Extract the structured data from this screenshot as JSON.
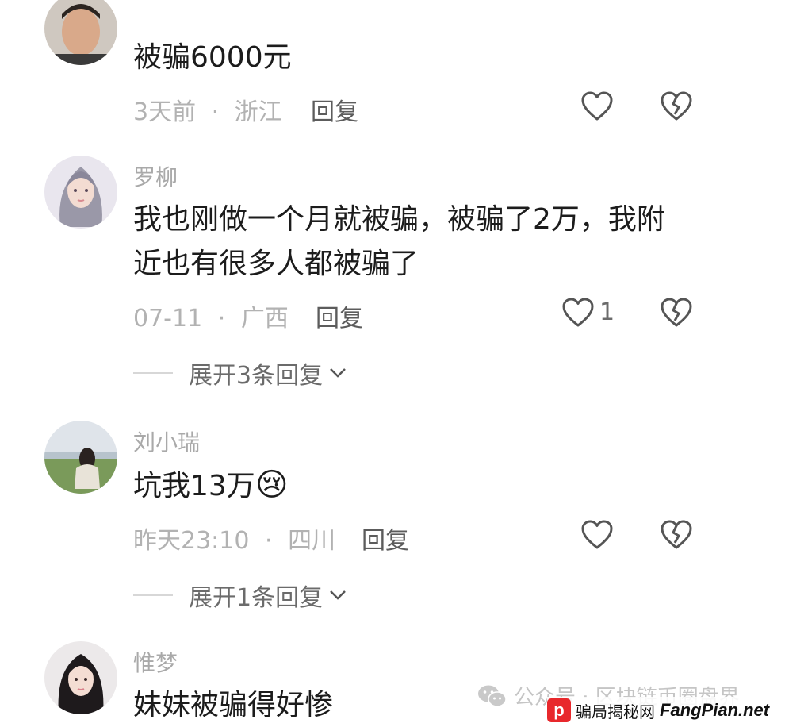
{
  "comments": [
    {
      "author": "",
      "text": "被骗6000元",
      "time": "3天前",
      "location": "浙江",
      "reply_label": "回复",
      "likes": ""
    },
    {
      "author": "罗柳",
      "text_line1": "我也刚做一个月就被骗，被骗了2万，我附",
      "text_line2": "近也有很多人都被骗了",
      "time": "07-11",
      "location": "广西",
      "reply_label": "回复",
      "likes": "1",
      "expand_label": "展开3条回复"
    },
    {
      "author": "刘小瑞",
      "text": "坑我13万",
      "emoji": "😢",
      "time": "昨天23:10",
      "location": "四川",
      "reply_label": "回复",
      "likes": "",
      "expand_label": "展开1条回复"
    },
    {
      "author": "惟梦",
      "text": "妹妹被骗得好惨"
    }
  ],
  "separator": "·",
  "watermark": {
    "line1": "公众号 · 区块链币圈盘界",
    "logo": "p",
    "cn": "骗局揭秘网",
    "en": "FangPian.net"
  },
  "icons": {
    "like": "heart-outline-icon",
    "dislike": "broken-heart-icon",
    "expand": "chevron-down-icon",
    "wechat": "wechat-icon"
  },
  "colors": {
    "meta_gray": "#b2b2b2",
    "author_gray": "#a9a9a9",
    "text": "#1c1c1c",
    "logo_red": "#e8282c"
  }
}
